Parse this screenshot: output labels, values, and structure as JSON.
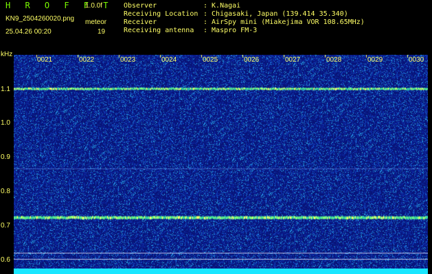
{
  "header": {
    "title": "H R O F F T",
    "version": "1.0.0f",
    "file": "KN9_2504260020.png",
    "datetime": "25.04.26 00:20",
    "mode": "meteor",
    "count": "19"
  },
  "info": [
    {
      "label": "Observer",
      "value": ": K.Nagai"
    },
    {
      "label": "Receiving Location",
      "value": ": Chigasaki, Japan (139.414 35.340)"
    },
    {
      "label": "Receiver",
      "value": ": AirSpy mini (Miakejima VOR 108.65MHz)"
    },
    {
      "label": "Receiving antenna",
      "value": ": Maspro FM-3"
    }
  ],
  "yaxis": {
    "unit": "kHz",
    "ticks": [
      "1.1",
      "1.0",
      "0.9",
      "0.8",
      "0.7",
      "0.6"
    ]
  },
  "xaxis": {
    "ticks": [
      "0021",
      "0022",
      "0023",
      "0024",
      "0025",
      "0026",
      "0027",
      "0028",
      "0029",
      "0030"
    ]
  },
  "colors": {
    "background": "#000000",
    "text": "#ffff66",
    "title": "#7CFC00",
    "noise_base": "#0a1a8a",
    "bottom_bar": "#19e6ff"
  }
}
